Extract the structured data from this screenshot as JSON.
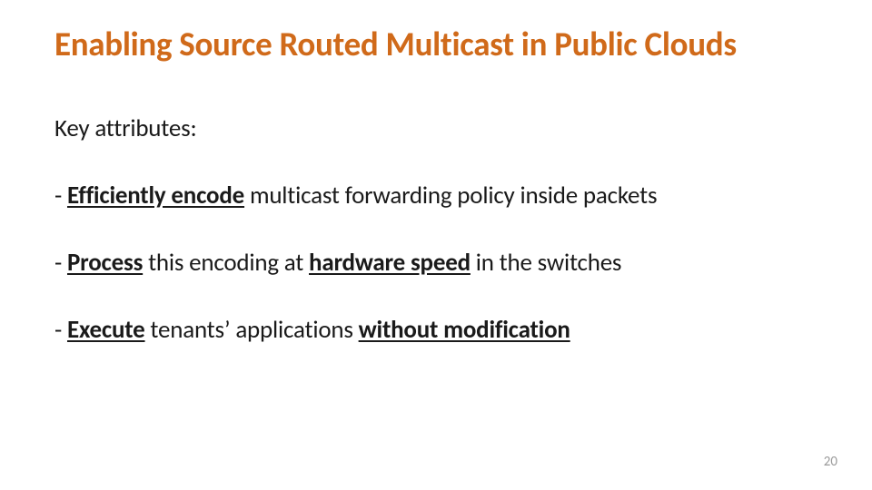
{
  "title": "Enabling Source Routed Multicast in Public Clouds",
  "lead": "Key attributes:",
  "bullets": [
    {
      "prefix": "- ",
      "strong1": "Efficiently encode",
      "mid": " multicast forwarding policy inside packets",
      "strong2": "",
      "tail": ""
    },
    {
      "prefix": "- ",
      "strong1": "Process",
      "mid": " this encoding at ",
      "strong2": "hardware speed",
      "tail": " in the switches"
    },
    {
      "prefix": "- ",
      "strong1": "Execute",
      "mid": " tenants’ applications ",
      "strong2": "without modification",
      "tail": ""
    }
  ],
  "page_number": "20"
}
